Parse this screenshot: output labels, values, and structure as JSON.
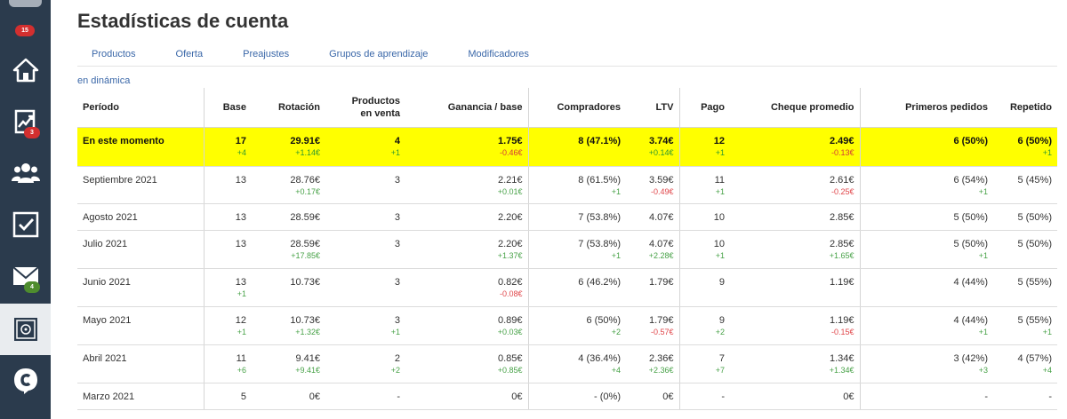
{
  "sidebar": {
    "badges": {
      "top": "15",
      "stats": "3",
      "mail": "4"
    },
    "items": [
      {
        "name": "home-icon"
      },
      {
        "name": "stats-chart-icon"
      },
      {
        "name": "users-icon"
      },
      {
        "name": "tasks-check-icon"
      },
      {
        "name": "mail-icon"
      },
      {
        "name": "safe-icon"
      },
      {
        "name": "chat-logo-icon"
      }
    ]
  },
  "header": {
    "title": "Estadísticas de cuenta"
  },
  "tabs": [
    "Productos",
    "Oferta",
    "Preajustes",
    "Grupos de aprendizaje",
    "Modificadores"
  ],
  "dynamics_link": "en dinámica",
  "table": {
    "columns": {
      "period": "Período",
      "base": "Base",
      "rotation": "Rotación",
      "products_line1": "Productos",
      "products_line2": "en venta",
      "gain": "Ganancia / base",
      "buyers": "Compradores",
      "ltv": "LTV",
      "payment": "Pago",
      "avg_check": "Cheque promedio",
      "first_orders": "Primeros pedidos",
      "repeat": "Repetido"
    },
    "rows": [
      {
        "period": "En este momento",
        "base": "17",
        "base_d": "+4",
        "rotation": "29.91€",
        "rotation_d": "+1.14€",
        "products": "4",
        "products_d": "+1",
        "gain": "1.75€",
        "gain_d": "-0.46€",
        "buyers": "8 (47.1%)",
        "buyers_d": "",
        "ltv": "3.74€",
        "ltv_d": "+0.14€",
        "payment": "12",
        "payment_d": "+1",
        "avg_check": "2.49€",
        "avg_check_d": "-0.13€",
        "first_orders": "6 (50%)",
        "first_orders_d": "",
        "repeat": "6 (50%)",
        "repeat_d": "+1"
      },
      {
        "period": "Septiembre 2021",
        "base": "13",
        "base_d": "",
        "rotation": "28.76€",
        "rotation_d": "+0.17€",
        "products": "3",
        "products_d": "",
        "gain": "2.21€",
        "gain_d": "+0.01€",
        "buyers": "8 (61.5%)",
        "buyers_d": "+1",
        "ltv": "3.59€",
        "ltv_d": "-0.49€",
        "payment": "11",
        "payment_d": "+1",
        "avg_check": "2.61€",
        "avg_check_d": "-0.25€",
        "first_orders": "6 (54%)",
        "first_orders_d": "+1",
        "repeat": "5 (45%)",
        "repeat_d": ""
      },
      {
        "period": "Agosto 2021",
        "base": "13",
        "base_d": "",
        "rotation": "28.59€",
        "rotation_d": "",
        "products": "3",
        "products_d": "",
        "gain": "2.20€",
        "gain_d": "",
        "buyers": "7 (53.8%)",
        "buyers_d": "",
        "ltv": "4.07€",
        "ltv_d": "",
        "payment": "10",
        "payment_d": "",
        "avg_check": "2.85€",
        "avg_check_d": "",
        "first_orders": "5 (50%)",
        "first_orders_d": "",
        "repeat": "5 (50%)",
        "repeat_d": ""
      },
      {
        "period": "Julio 2021",
        "base": "13",
        "base_d": "",
        "rotation": "28.59€",
        "rotation_d": "+17.85€",
        "products": "3",
        "products_d": "",
        "gain": "2.20€",
        "gain_d": "+1.37€",
        "buyers": "7 (53.8%)",
        "buyers_d": "+1",
        "ltv": "4.07€",
        "ltv_d": "+2.28€",
        "payment": "10",
        "payment_d": "+1",
        "avg_check": "2.85€",
        "avg_check_d": "+1.65€",
        "first_orders": "5 (50%)",
        "first_orders_d": "+1",
        "repeat": "5 (50%)",
        "repeat_d": ""
      },
      {
        "period": "Junio 2021",
        "base": "13",
        "base_d": "+1",
        "rotation": "10.73€",
        "rotation_d": "",
        "products": "3",
        "products_d": "",
        "gain": "0.82€",
        "gain_d": "-0.08€",
        "buyers": "6 (46.2%)",
        "buyers_d": "",
        "ltv": "1.79€",
        "ltv_d": "",
        "payment": "9",
        "payment_d": "",
        "avg_check": "1.19€",
        "avg_check_d": "",
        "first_orders": "4 (44%)",
        "first_orders_d": "",
        "repeat": "5 (55%)",
        "repeat_d": ""
      },
      {
        "period": "Mayo 2021",
        "base": "12",
        "base_d": "+1",
        "rotation": "10.73€",
        "rotation_d": "+1.32€",
        "products": "3",
        "products_d": "+1",
        "gain": "0.89€",
        "gain_d": "+0.03€",
        "buyers": "6 (50%)",
        "buyers_d": "+2",
        "ltv": "1.79€",
        "ltv_d": "-0.57€",
        "payment": "9",
        "payment_d": "+2",
        "avg_check": "1.19€",
        "avg_check_d": "-0.15€",
        "first_orders": "4 (44%)",
        "first_orders_d": "+1",
        "repeat": "5 (55%)",
        "repeat_d": "+1"
      },
      {
        "period": "Abril 2021",
        "base": "11",
        "base_d": "+6",
        "rotation": "9.41€",
        "rotation_d": "+9.41€",
        "products": "2",
        "products_d": "+2",
        "gain": "0.85€",
        "gain_d": "+0.85€",
        "buyers": "4 (36.4%)",
        "buyers_d": "+4",
        "ltv": "2.36€",
        "ltv_d": "+2.36€",
        "payment": "7",
        "payment_d": "+7",
        "avg_check": "1.34€",
        "avg_check_d": "+1.34€",
        "first_orders": "3 (42%)",
        "first_orders_d": "+3",
        "repeat": "4 (57%)",
        "repeat_d": "+4"
      },
      {
        "period": "Marzo 2021",
        "base": "5",
        "base_d": "",
        "rotation": "0€",
        "rotation_d": "",
        "products": "-",
        "products_d": "",
        "gain": "0€",
        "gain_d": "",
        "buyers": "- (0%)",
        "buyers_d": "",
        "ltv": "0€",
        "ltv_d": "",
        "payment": "-",
        "payment_d": "",
        "avg_check": "0€",
        "avg_check_d": "",
        "first_orders": "-",
        "first_orders_d": "",
        "repeat": "-",
        "repeat_d": ""
      }
    ]
  }
}
